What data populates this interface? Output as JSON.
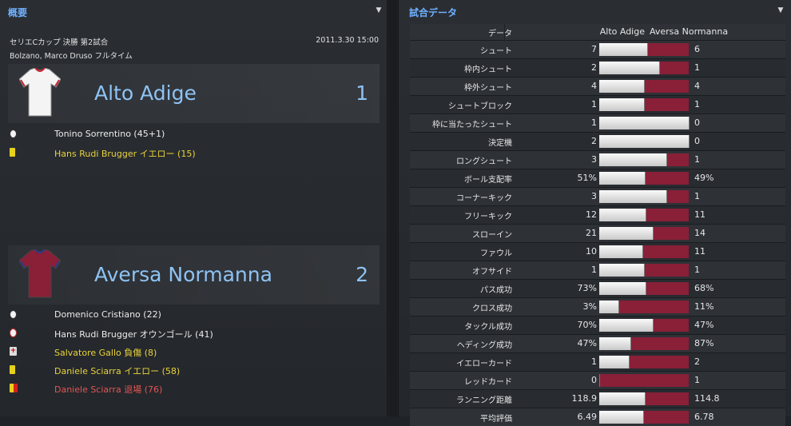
{
  "left_panel": {
    "title": "概要",
    "competition": "セリエCカップ 決勝 第2試合",
    "datetime": "2011.3.30 15:00",
    "venue": "Bolzano, Marco Druso フルタイム",
    "home": {
      "name": "Alto Adige",
      "score": "1",
      "shirt_color": "#ffffff",
      "events": [
        {
          "icon": "goal",
          "text": "Tonino Sorrentino (45+1)",
          "style": "white"
        },
        {
          "icon": "yellow-card",
          "text": "Hans Rudi Brugger イエロー (15)",
          "style": "yellow"
        }
      ]
    },
    "away": {
      "name": "Aversa Normanna",
      "score": "2",
      "shirt_color": "#8a1f38",
      "events": [
        {
          "icon": "goal",
          "text": "Domenico Cristiano (22)",
          "style": "white"
        },
        {
          "icon": "own-goal",
          "text": "Hans Rudi Brugger オウンゴール (41)",
          "style": "white"
        },
        {
          "icon": "injury",
          "text": "Salvatore Gallo 負傷 (8)",
          "style": "yellow"
        },
        {
          "icon": "yellow-card",
          "text": "Daniele Sciarra イエロー (58)",
          "style": "yellow"
        },
        {
          "icon": "red-card",
          "text": "Daniele Sciarra 退場 (76)",
          "style": "red"
        }
      ]
    }
  },
  "right_panel": {
    "title": "試合データ",
    "header": {
      "label": "データ",
      "team1": "Alto Adige",
      "team2": "Aversa Normanna"
    },
    "colors": {
      "team1": "#f0f0f0",
      "team2": "#8a1f38"
    },
    "stats": [
      {
        "label": "シュート",
        "v1": "7",
        "v2": "6",
        "share1": 0.54
      },
      {
        "label": "枠内シュート",
        "v1": "2",
        "v2": "1",
        "share1": 0.67
      },
      {
        "label": "枠外シュート",
        "v1": "4",
        "v2": "4",
        "share1": 0.5
      },
      {
        "label": "シュートブロック",
        "v1": "1",
        "v2": "1",
        "share1": 0.5
      },
      {
        "label": "枠に当たったシュート",
        "v1": "1",
        "v2": "0",
        "share1": 1.0
      },
      {
        "label": "決定機",
        "v1": "2",
        "v2": "0",
        "share1": 1.0
      },
      {
        "label": "ロングシュート",
        "v1": "3",
        "v2": "1",
        "share1": 0.75
      },
      {
        "label": "ボール支配率",
        "v1": "51%",
        "v2": "49%",
        "share1": 0.51
      },
      {
        "label": "コーナーキック",
        "v1": "3",
        "v2": "1",
        "share1": 0.75
      },
      {
        "label": "フリーキック",
        "v1": "12",
        "v2": "11",
        "share1": 0.52
      },
      {
        "label": "スローイン",
        "v1": "21",
        "v2": "14",
        "share1": 0.6
      },
      {
        "label": "ファウル",
        "v1": "10",
        "v2": "11",
        "share1": 0.48
      },
      {
        "label": "オフサイド",
        "v1": "1",
        "v2": "1",
        "share1": 0.5
      },
      {
        "label": "パス成功",
        "v1": "73%",
        "v2": "68%",
        "share1": 0.52
      },
      {
        "label": "クロス成功",
        "v1": "3%",
        "v2": "11%",
        "share1": 0.21
      },
      {
        "label": "タックル成功",
        "v1": "70%",
        "v2": "47%",
        "share1": 0.6
      },
      {
        "label": "ヘディング成功",
        "v1": "47%",
        "v2": "87%",
        "share1": 0.35
      },
      {
        "label": "イエローカード",
        "v1": "1",
        "v2": "2",
        "share1": 0.33
      },
      {
        "label": "レッドカード",
        "v1": "0",
        "v2": "1",
        "share1": 0.0
      },
      {
        "label": "ランニング距離",
        "v1": "118.9",
        "v2": "114.8",
        "share1": 0.51
      },
      {
        "label": "平均評価",
        "v1": "6.49",
        "v2": "6.78",
        "share1": 0.49
      }
    ]
  }
}
